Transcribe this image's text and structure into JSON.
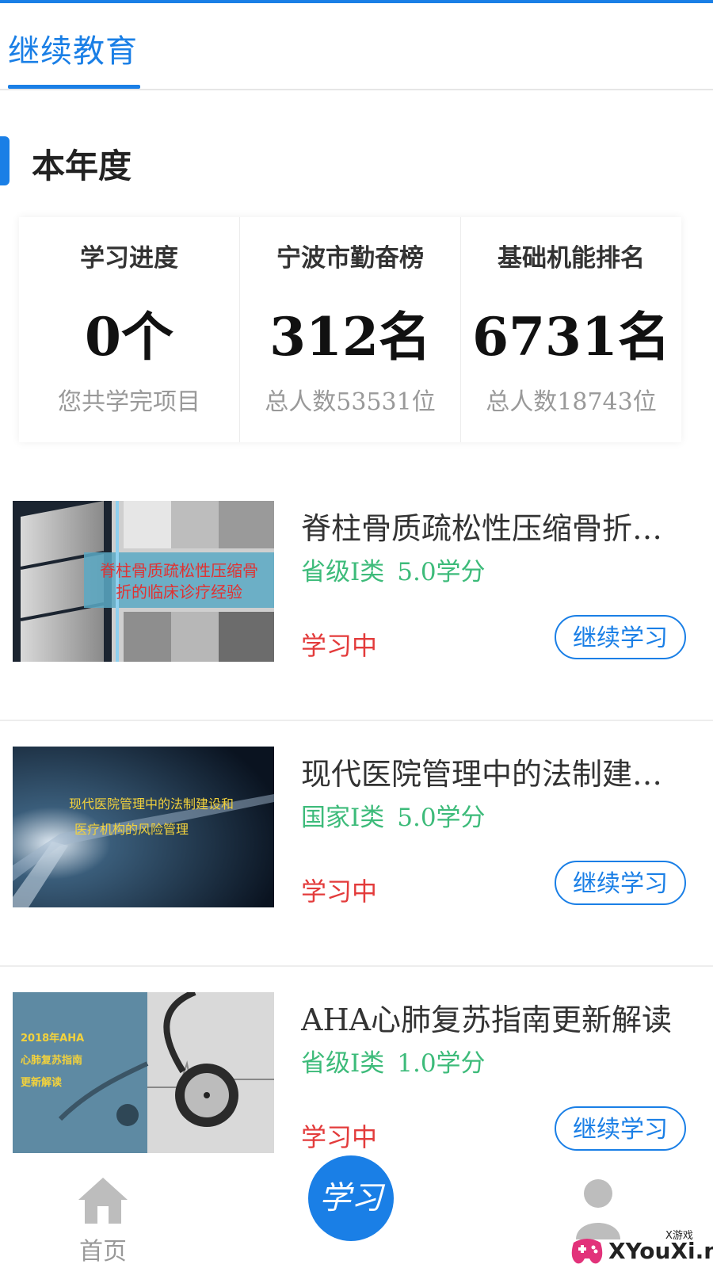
{
  "header": {
    "tab_active": "继续教育"
  },
  "section": {
    "title": "本年度"
  },
  "stats": [
    {
      "label": "学习进度",
      "value": "0个",
      "sub": "您共学完项目"
    },
    {
      "label": "宁波市勤奋榜",
      "value": "312名",
      "sub": "总人数53531位"
    },
    {
      "label": "基础机能排名",
      "value": "6731名",
      "sub": "总人数18743位"
    }
  ],
  "courses": [
    {
      "title": "脊柱骨质疏松性压缩骨折…",
      "level": "省级I类",
      "credits": "5.0学分",
      "status": "学习中",
      "button": "继续学习",
      "thumb_text": [
        "脊柱骨质疏松性压缩骨",
        "折的临床诊疗经验"
      ]
    },
    {
      "title": "现代医院管理中的法制建…",
      "level": "国家I类",
      "credits": "5.0学分",
      "status": "学习中",
      "button": "继续学习",
      "thumb_text": [
        "现代医院管理中的法制建设和",
        "医疗机构的风险管理"
      ]
    },
    {
      "title": "AHA心肺复苏指南更新解读",
      "level": "省级I类",
      "credits": "1.0学分",
      "status": "学习中",
      "button": "继续学习",
      "thumb_text": [
        "2018年AHA",
        "心肺复苏指南",
        "更新解读"
      ]
    }
  ],
  "bottom_nav": {
    "home_label": "首页",
    "study_label": "学习"
  },
  "watermark": {
    "top": "X游戏",
    "main": "XYouXi.net"
  },
  "colors": {
    "accent": "#1a7fe6",
    "green": "#3dbb7a",
    "red": "#e33b3b"
  }
}
